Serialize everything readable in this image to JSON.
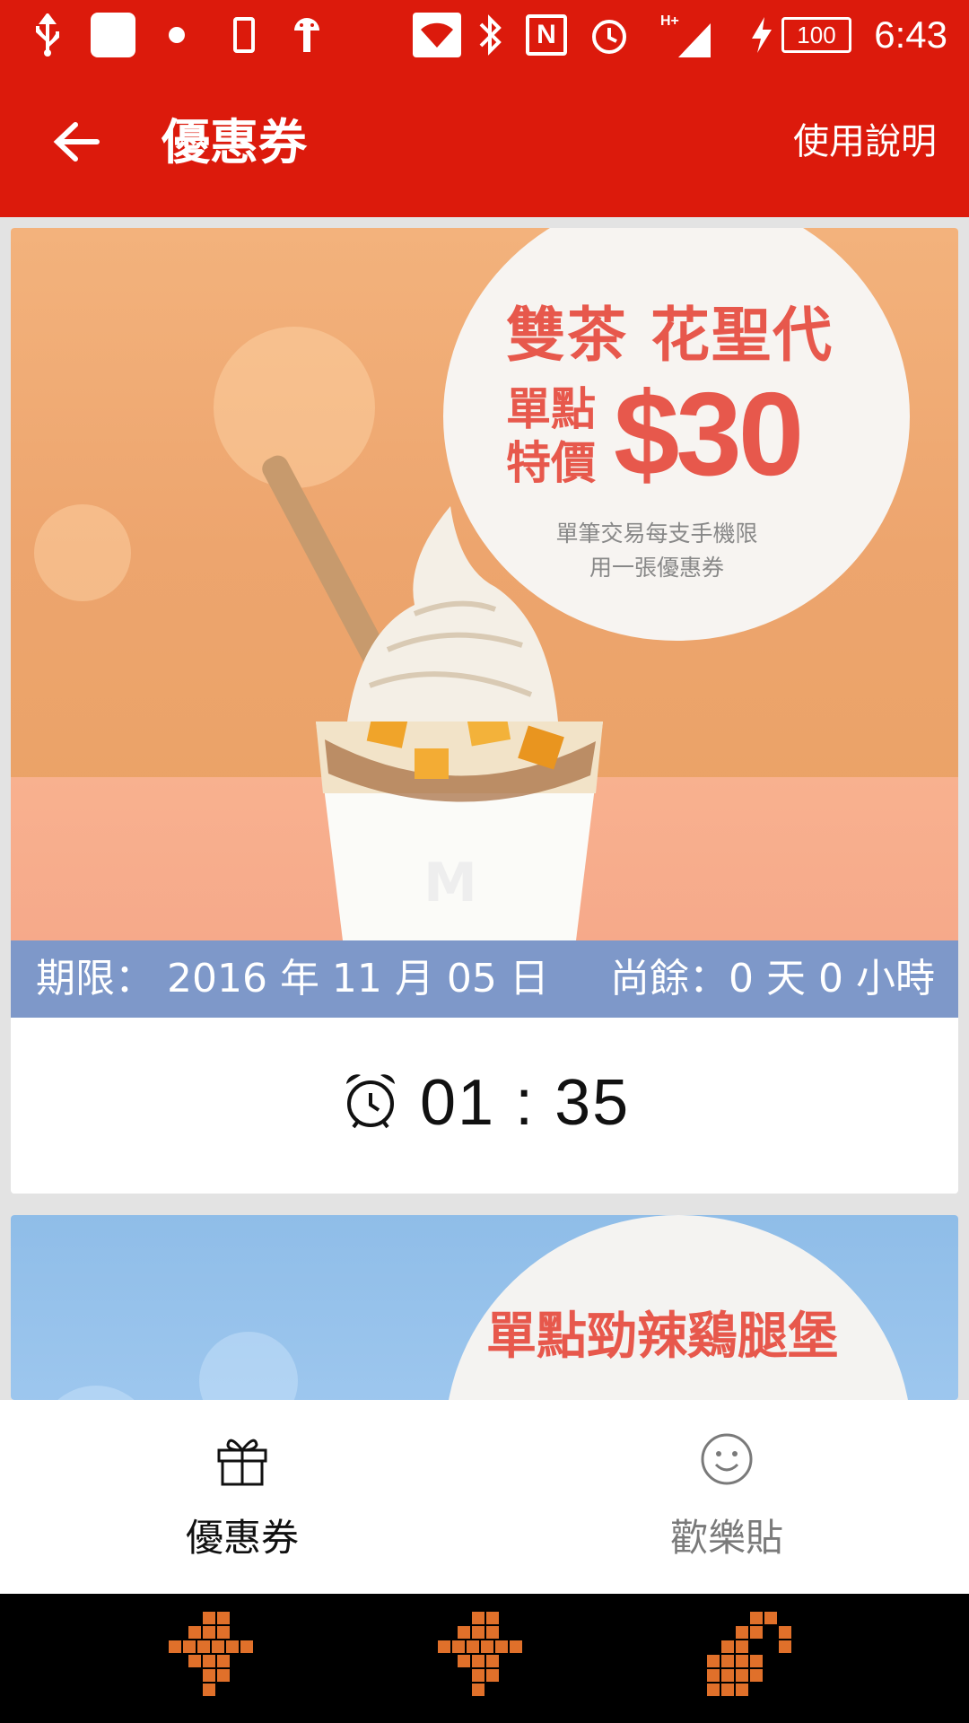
{
  "status_bar": {
    "time": "6:43",
    "battery": "100",
    "network": "H+",
    "icons": [
      "usb-icon",
      "app-notification-icon",
      "dot-icon",
      "phone-icon",
      "android-icon",
      "wifi-icon",
      "bluetooth-icon",
      "nfc-icon",
      "alarm-icon",
      "signal-icon",
      "charging-icon",
      "battery-icon"
    ]
  },
  "app_bar": {
    "title": "優惠券",
    "help_label": "使用說明",
    "back_icon": "back-arrow-icon"
  },
  "coupons": [
    {
      "promo_title": "雙茶 花聖代",
      "promo_subtitle": "單點特價",
      "promo_price": "$30",
      "promo_note": "單筆交易每支手機限用一張優惠券",
      "expiry_label": "期限： 2016 年 11 月 05 日",
      "remaining_label": "尚餘：0 天 0 小時",
      "countdown": "01 : 35",
      "colors": {
        "banner": "#eda56e",
        "expiry_bar": "#7e98c9",
        "promo_text": "#e7584c"
      }
    },
    {
      "promo_title": "單點勁辣鷄腿堡",
      "colors": {
        "banner": "#9fc8ef"
      }
    }
  ],
  "tabs": [
    {
      "label": "優惠券",
      "icon": "gift-icon",
      "selected": true
    },
    {
      "label": "歡樂貼",
      "icon": "smiley-icon",
      "selected": false
    }
  ],
  "nav_bar": {
    "buttons": [
      "nav-back-button",
      "nav-home-button",
      "nav-recents-button"
    ],
    "color": "#e0702a"
  },
  "colors": {
    "primary": "#dc1a0c"
  }
}
